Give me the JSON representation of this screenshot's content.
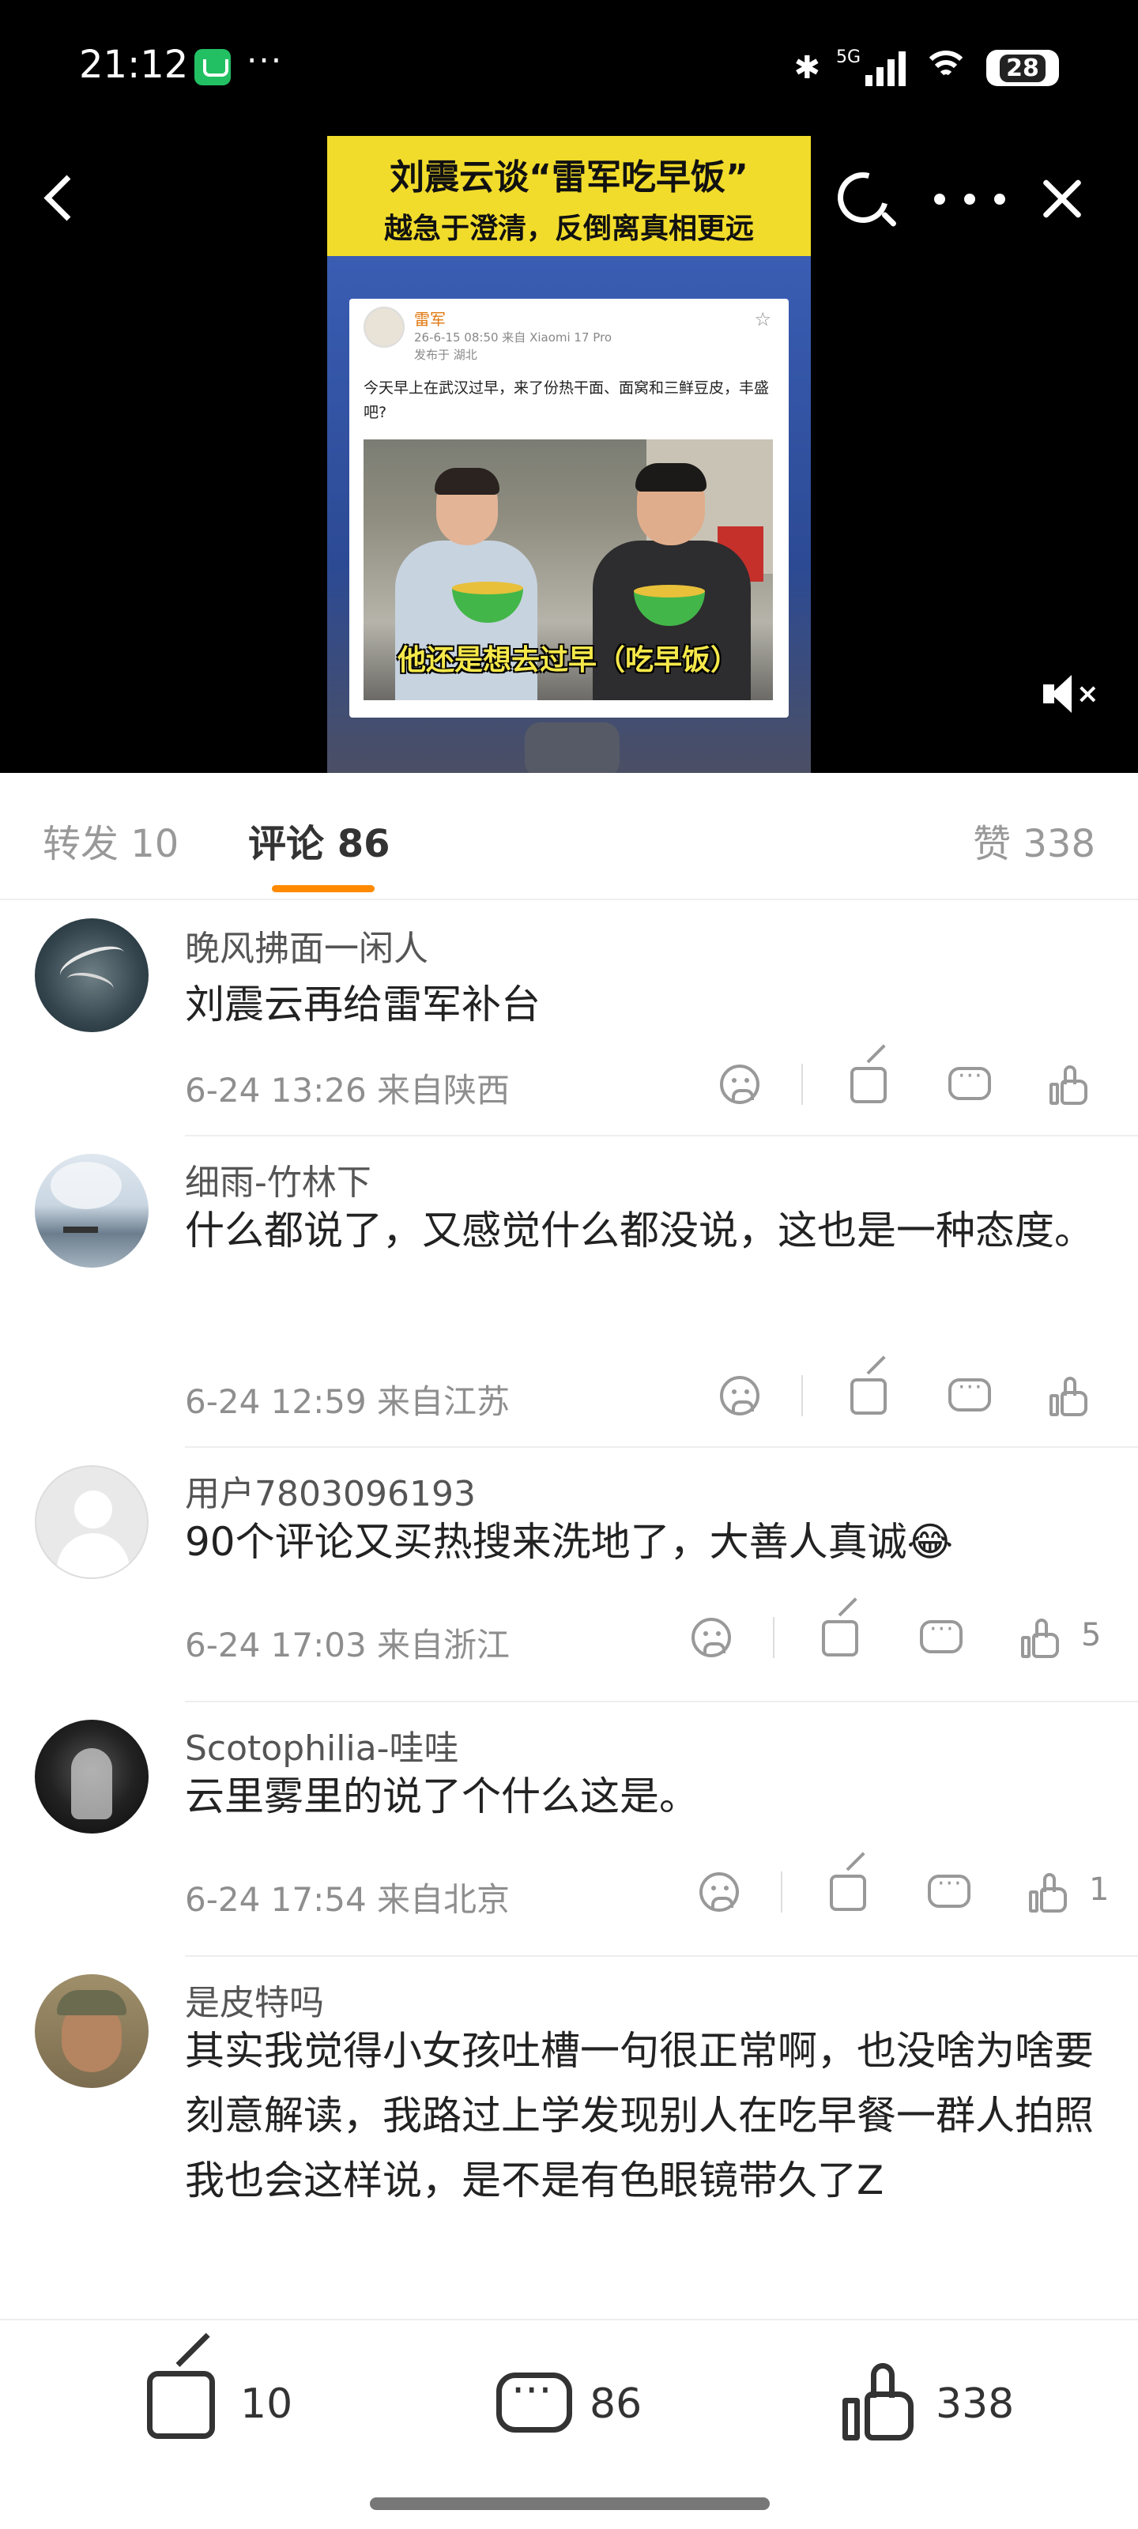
{
  "status_bar": {
    "time": "21:12",
    "network": "5G",
    "battery": "28",
    "more": "···"
  },
  "video": {
    "banner_title": "刘震云谈“雷军吃早饭”",
    "banner_subtitle": "越急于澄清，反倒离真相更远",
    "post_author": "雷军",
    "post_meta": "26-6-15 08:50  来自 Xiaomi 17 Pro",
    "post_location": "发布于 湖北",
    "post_text": "今天早上在武汉过早，来了份热干面、面窝和三鲜豆皮，丰盛吧?",
    "caption": "他还是想去过早（吃早饭）"
  },
  "tabs": {
    "repost": "转发 10",
    "comment": "评论 86",
    "likes": "赞 338"
  },
  "comments": [
    {
      "name": "晚风拂面一闲人",
      "text": "刘震云再给雷军补台",
      "meta": "6-24 13:26  来自陕西",
      "likes": ""
    },
    {
      "name": "细雨-竹林下",
      "text": "什么都说了，又感觉什么都没说，这也是一种态度。",
      "meta": "6-24 12:59  来自江苏",
      "likes": ""
    },
    {
      "name": "用户7803096193",
      "text": "90个评论又买热搜来洗地了，大善人真诚😂",
      "meta": "6-24 17:03  来自浙江",
      "likes": "5"
    },
    {
      "name": "Scotophilia-哇哇",
      "text": "云里雾里的说了个什么这是。",
      "meta": "6-24 17:54  来自北京",
      "likes": "1"
    },
    {
      "name": "是皮特吗",
      "text": "其实我觉得小女孩吐槽一句很正常啊，也没啥为啥要刻意解读，我路过上学发现别人在吃早餐一群人拍照我也会这样说，是不是有色眼镜带久了Z",
      "meta": "",
      "likes": ""
    }
  ],
  "bottom_bar": {
    "repost_count": "10",
    "comment_count": "86",
    "like_count": "338"
  },
  "colors": {
    "tab_indicator": "#ff8a00",
    "banner_yellow": "#f2dc2b",
    "caption_yellow": "#f5e84a"
  }
}
